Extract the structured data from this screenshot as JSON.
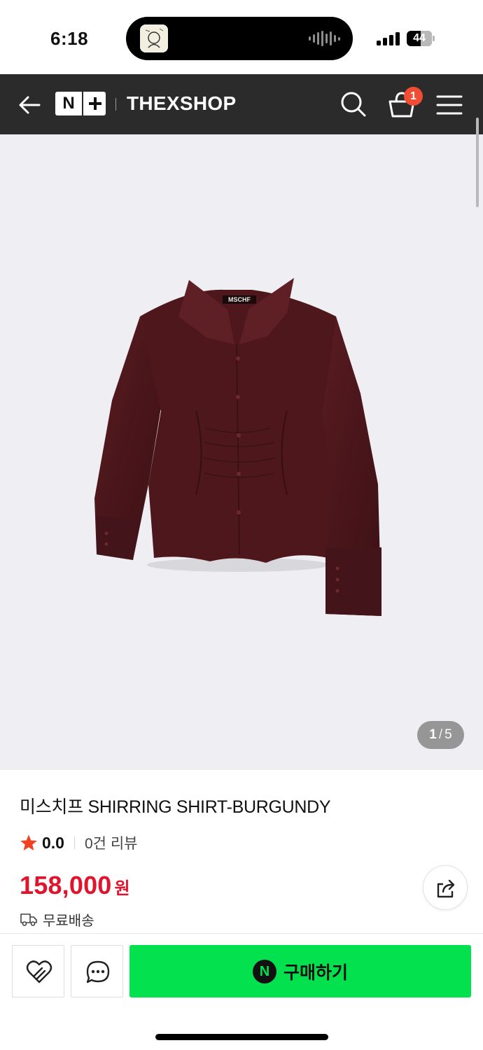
{
  "status_bar": {
    "time": "6:18",
    "battery_level": "44"
  },
  "header": {
    "logo_text": "N",
    "shop_name": "THEXSHOP",
    "cart_count": "1",
    "background": "#2b2b2b"
  },
  "gallery": {
    "current_page": "1",
    "total_pages": "5",
    "separator": "/",
    "shirt_label": "MSCHF"
  },
  "product": {
    "title": "미스치프 SHIRRING SHIRT-BURGUNDY",
    "rating": "0.0",
    "review_count": "0건 리뷰",
    "price": "158,000",
    "price_unit": "원",
    "shipping": "무료배송",
    "price_color": "#e0152d"
  },
  "bottom_bar": {
    "buy_icon": "N",
    "buy_label": "구매하기",
    "buy_color": "#03e14f"
  },
  "icons": {
    "back": "back-arrow-icon",
    "search": "search-icon",
    "cart": "cart-icon",
    "menu": "hamburger-menu-icon",
    "star": "star-icon",
    "share": "share-icon",
    "shipping": "truck-icon",
    "like": "heart-icon",
    "talk": "chat-bubble-icon"
  }
}
